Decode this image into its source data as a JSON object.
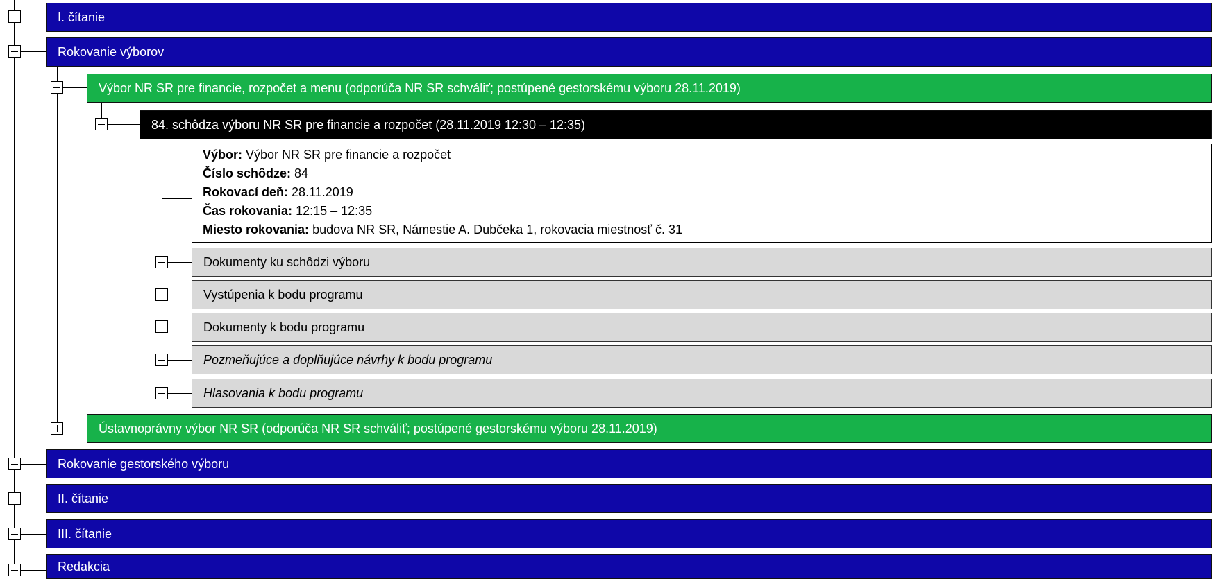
{
  "sections": {
    "first_reading": "I. čítanie",
    "committee_proceedings": "Rokovanie výborov",
    "lead_committee": "Rokovanie gestorského výboru",
    "second_reading": "II. čítanie",
    "third_reading": "III. čítanie",
    "editing": "Redakcia"
  },
  "committees": [
    "Výbor NR SR pre financie, rozpočet a menu (odporúča NR SR schváliť; postúpené gestorskému výboru 28.11.2019)",
    "Ústavnoprávny výbor NR SR (odporúča NR SR schváliť; postúpené gestorskému výboru 28.11.2019)"
  ],
  "meeting": {
    "title": "84. schôdza výboru NR SR pre financie a rozpočet  (28.11.2019 12:30 – 12:35)",
    "details": [
      {
        "label": "Výbor:",
        "value": "Výbor NR SR pre financie a rozpočet"
      },
      {
        "label": "Číslo schôdze:",
        "value": "84"
      },
      {
        "label": "Rokovací deň:",
        "value": "28.11.2019"
      },
      {
        "label": "Čas rokovania:",
        "value": "12:15 – 12:35"
      },
      {
        "label": "Miesto rokovania:",
        "value": "budova NR SR, Námestie A. Dubčeka 1, rokovacia miestnosť č. 31"
      }
    ],
    "items": [
      "Dokumenty ku schôdzi výboru",
      "Vystúpenia k bodu programu",
      "Dokumenty k bodu programu",
      "Pozmeňujúce a doplňujúce návrhy k bodu programu",
      "Hlasovania k bodu programu"
    ]
  },
  "colors": {
    "section": "#0f07a8",
    "committee": "#17b24a",
    "meeting": "#000000",
    "item": "#d9d9d9"
  }
}
